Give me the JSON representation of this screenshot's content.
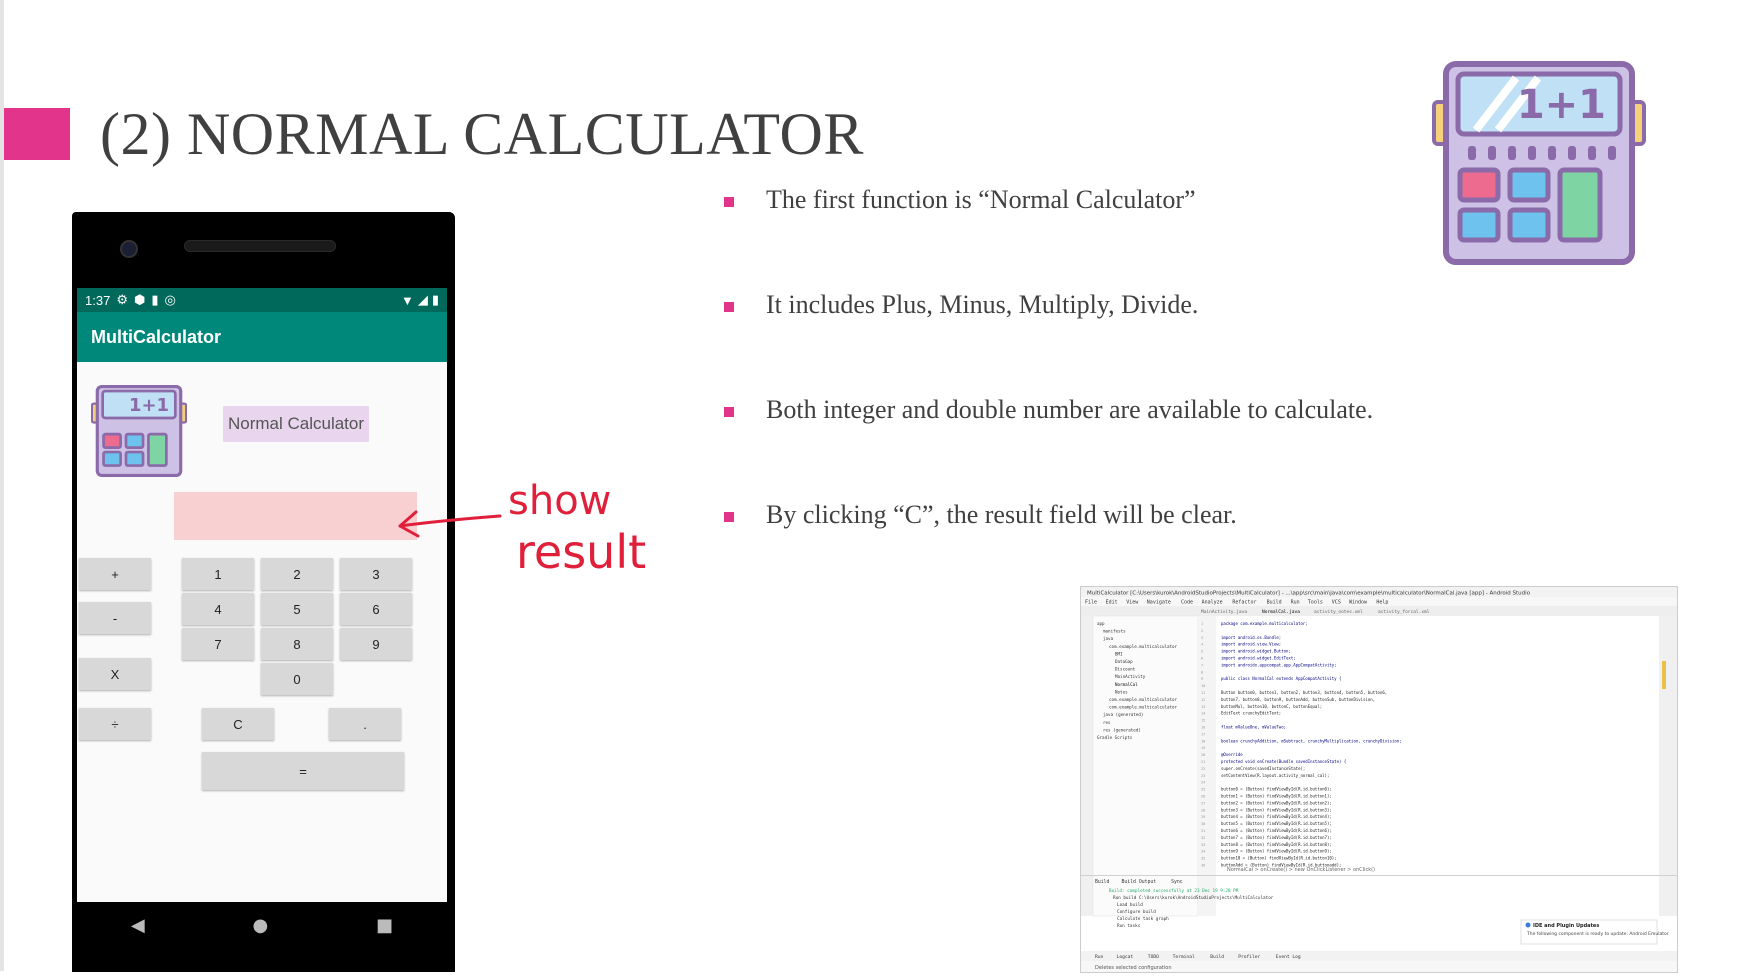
{
  "slide": {
    "title": "(2) NORMAL CALCULATOR",
    "accent_color": "#e3348c",
    "bullets": [
      "The first function is “Normal Calculator”",
      "It includes Plus, Minus, Multiply, Divide.",
      "Both integer and double number are available to calculate.",
      "By clicking “C”, the result field will be clear."
    ],
    "annotation_line1": "show",
    "annotation_line2": "result",
    "annotation_color": "#e0203a",
    "decor_icon": "calculator-icon",
    "decor_icon_text": "1+1"
  },
  "phone": {
    "status_time": "1:37",
    "status_icons_left": [
      "gear-icon",
      "shield-icon",
      "sd-card-icon",
      "sync-icon"
    ],
    "status_icons_right": [
      "wifi-icon",
      "signal-icon",
      "battery-icon"
    ],
    "app_title": "MultiCalculator",
    "app_icon": "calculator-icon",
    "screen_label": "Normal Calculator",
    "operators": [
      "+",
      "-",
      "X",
      "÷"
    ],
    "digits": [
      "1",
      "2",
      "3",
      "4",
      "5",
      "6",
      "7",
      "8",
      "9",
      "0"
    ],
    "clear_label": "C",
    "dot_label": ".",
    "equals_label": "=",
    "nav": {
      "back": "◀",
      "home": "●",
      "recents": "■"
    },
    "colors": {
      "status": "#00695c",
      "appbar": "#00897b",
      "result": "#f8d0d2",
      "label_bg": "#e9d6ee"
    }
  },
  "ide_screenshot": {
    "window_title": "MultiCalculator [C:\\Users\\kurok\\AndroidStudioProjects\\MultiCalculator] - ...\\app\\src\\main\\java\\com\\example\\multicalculator\\NormalCal.java [app] - Android Studio",
    "menu": [
      "File",
      "Edit",
      "View",
      "Navigate",
      "Code",
      "Analyze",
      "Refactor",
      "Build",
      "Run",
      "Tools",
      "VCS",
      "Window",
      "Help"
    ],
    "tabs": [
      "MainActivity.java",
      "NormalCal.java",
      "activity_notes.xml",
      "activity_forcal.xml"
    ],
    "tree": [
      "app",
      "manifests",
      "java",
      "com.example.multicalculator",
      "BMI",
      "DataGap",
      "Discount",
      "MainActivity",
      "NormalCal",
      "Notes",
      "com.example.multicalculator",
      "com.example.multicalculator",
      "java (generated)",
      "res",
      "res (generated)",
      "Gradle Scripts"
    ],
    "code": [
      "package com.example.multicalculator;",
      "",
      "import android.os.Bundle;",
      "import android.view.View;",
      "import android.widget.Button;",
      "import android.widget.EditText;",
      "import androidx.appcompat.app.AppCompatActivity;",
      "",
      "public class NormalCal extends AppCompatActivity {",
      "",
      "    Button button0, button1, button2, button3, button4, button5, button6,",
      "           button7, button8, button9, buttonAdd, buttonSub, buttonDivision,",
      "           buttonMul, button10, buttonC, buttonEqual;",
      "    EditText crunchyEditText;",
      "",
      "    float mValueOne, mValueTwo;",
      "",
      "    boolean crunchyAddition, mSubtract, crunchyMultiplication, crunchyDivision;",
      "",
      "    @Override",
      "    protected void onCreate(Bundle savedInstanceState) {",
      "        super.onCreate(savedInstanceState);",
      "        setContentView(R.layout.activity_normal_cal);",
      "",
      "        button0 = (Button) findViewById(R.id.button0);",
      "        button1 = (Button) findViewById(R.id.button1);",
      "        button2 = (Button) findViewById(R.id.button2);",
      "        button3 = (Button) findViewById(R.id.button3);",
      "        button4 = (Button) findViewById(R.id.button4);",
      "        button5 = (Button) findViewById(R.id.button5);",
      "        button6 = (Button) findViewById(R.id.button6);",
      "        button7 = (Button) findViewById(R.id.button7);",
      "        button8 = (Button) findViewById(R.id.button8);",
      "        button9 = (Button) findViewById(R.id.button9);",
      "        button10 = (Button) findViewById(R.id.button10);",
      "        buttonAdd = (Button) findViewById(R.id.buttonadd);"
    ],
    "breadcrumb": "NormalCal > onCreate() > new OnClickListener > onClick()",
    "build_tabs": [
      "Build",
      "Build Output",
      "Sync"
    ],
    "build_lines": [
      "Build: completed successfully at 23 Dec 19 9:28 PM",
      "Run build C:\\Users\\kurok\\AndroidStudioProjects\\MultiCalculator",
      "Load build",
      "Configure build",
      "Calculate task graph",
      "Run tasks"
    ],
    "notification_title": "IDE and Plugin Updates",
    "notification_body": "The following component is ready to update: Android Emulator",
    "bottom_tabs": [
      "Run",
      "Logcat",
      "TODO",
      "Terminal",
      "Build",
      "Profiler",
      "Event Log"
    ],
    "status": "Deletes selected configuration"
  }
}
